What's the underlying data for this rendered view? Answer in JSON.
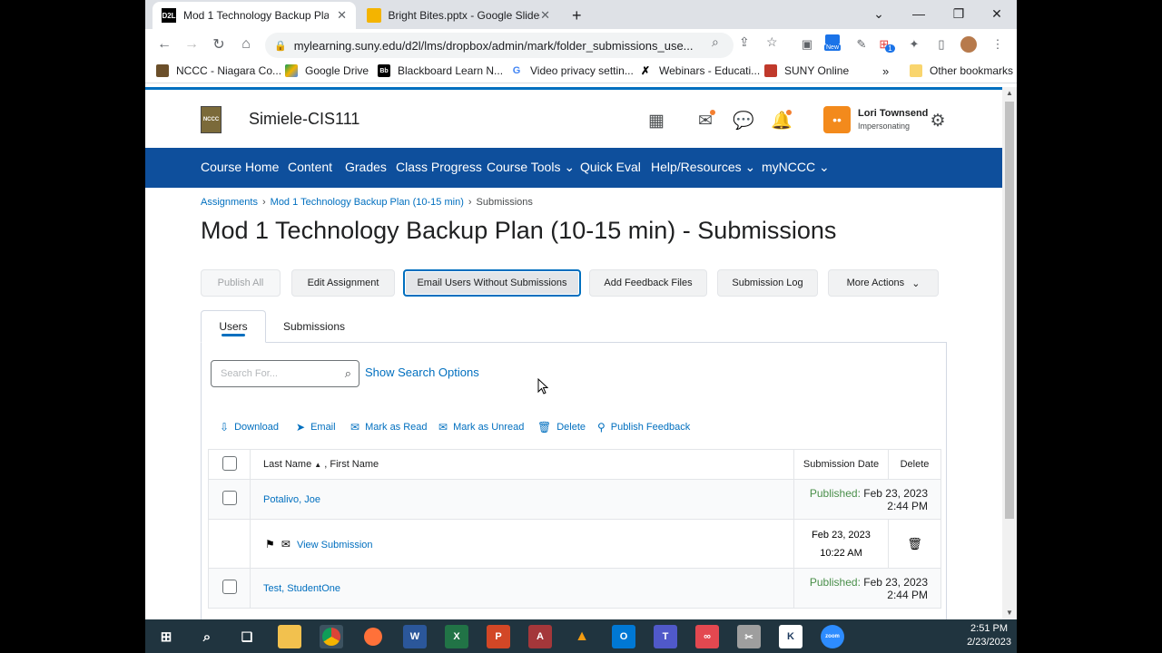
{
  "browser": {
    "tabs": [
      {
        "label": "Mod 1 Technology Backup Plan (",
        "favicon": "D2L",
        "active": true
      },
      {
        "label": "Bright Bites.pptx - Google Slides",
        "favicon": "slides-icon",
        "active": false
      }
    ],
    "new_tab": "+",
    "url": "mylearning.suny.edu/d2l/lms/dropbox/admin/mark/folder_submissions_use...",
    "ext_badge_new": "New",
    "ext_badge_count": "1",
    "bookmarks": [
      {
        "label": "NCCC - Niagara Co...",
        "icon": "nccc-icon"
      },
      {
        "label": "Google Drive",
        "icon": "drive-icon"
      },
      {
        "label": "Blackboard Learn N...",
        "icon": "blackboard-icon"
      },
      {
        "label": "Video privacy settin...",
        "icon": "google-icon"
      },
      {
        "label": "Webinars - Educati...",
        "icon": "webinar-icon"
      },
      {
        "label": "SUNY Online",
        "icon": "suny-icon"
      }
    ],
    "more_bookmarks": "»",
    "other_bookmarks": "Other bookmarks"
  },
  "minibar": {
    "logo_text": "NCCC",
    "course_title": "Simiele-CIS111",
    "user_name": "Lori Townsend",
    "user_role": "Impersonating"
  },
  "navbar": [
    {
      "label": "Course Home"
    },
    {
      "label": "Content"
    },
    {
      "label": "Grades"
    },
    {
      "label": "Class Progress"
    },
    {
      "label": "Course Tools ⌄"
    },
    {
      "label": "Quick Eval"
    },
    {
      "label": "Help/Resources ⌄"
    },
    {
      "label": "myNCCC ⌄"
    }
  ],
  "breadcrumb": {
    "item1": "Assignments",
    "item2": "Mod 1 Technology Backup Plan (10-15 min)",
    "current": "Submissions"
  },
  "page_title": "Mod 1 Technology Backup Plan (10-15 min) - Submissions",
  "buttons": {
    "publish_all": "Publish All",
    "edit_assignment": "Edit Assignment",
    "email_users": "Email Users Without Submissions",
    "add_feedback": "Add Feedback Files",
    "submission_log": "Submission Log",
    "more_actions": "More Actions"
  },
  "page_tabs": {
    "users": "Users",
    "submissions": "Submissions"
  },
  "search": {
    "placeholder": "Search For...",
    "show_options": "Show Search Options"
  },
  "actions": {
    "download": "Download",
    "email": "Email",
    "mark_read": "Mark as Read",
    "mark_unread": "Mark as Unread",
    "delete": "Delete",
    "publish_feedback": "Publish Feedback"
  },
  "table": {
    "col_last": "Last Name",
    "col_first": ", First Name",
    "col_date": "Submission Date",
    "col_delete": "Delete",
    "rows": [
      {
        "name": "Potalivo, Joe",
        "status": "Published:",
        "date": "Feb 23, 2023 2:44 PM"
      },
      {
        "view": "View Submission",
        "sub_date_1": "Feb 23, 2023",
        "sub_date_2": "10:22 AM"
      },
      {
        "name": "Test, StudentOne",
        "status": "Published:",
        "date": "Feb 23, 2023 2:44 PM"
      }
    ]
  },
  "taskbar": {
    "time": "2:51 PM",
    "date": "2/23/2023"
  },
  "colors": {
    "navbar": "#0e4f9c",
    "link": "#006fbf",
    "published": "#4a8f4a",
    "accent_orange": "#f38a1c",
    "taskbar": "#20343f"
  }
}
